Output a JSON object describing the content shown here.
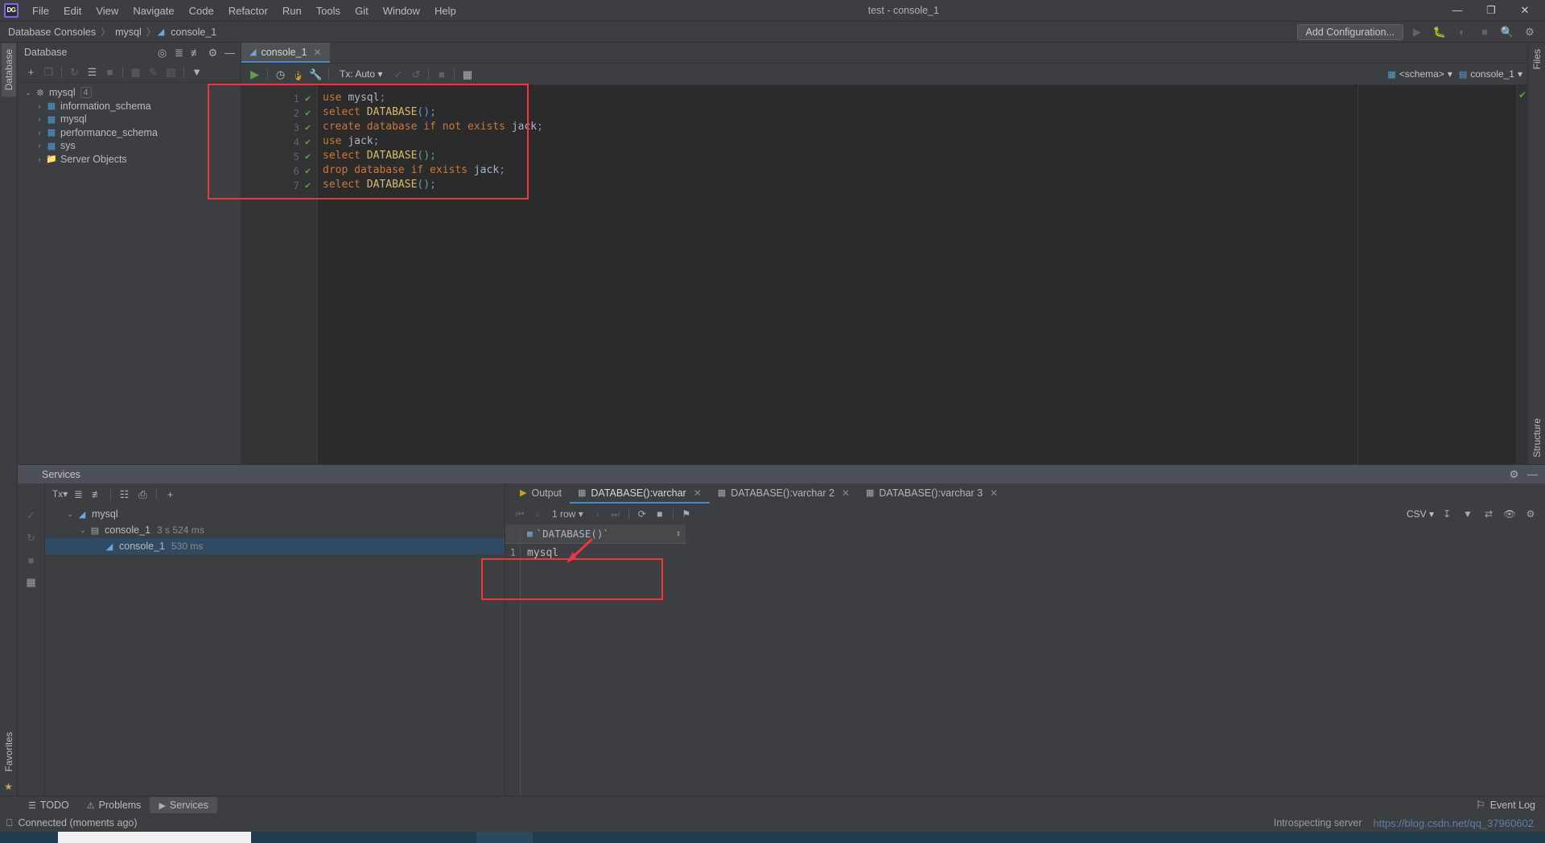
{
  "window": {
    "title": "test - console_1",
    "logo_text": "DG",
    "minimize": "—",
    "maximize": "❐",
    "close": "✕"
  },
  "menu": [
    "File",
    "Edit",
    "View",
    "Navigate",
    "Code",
    "Refactor",
    "Run",
    "Tools",
    "Git",
    "Window",
    "Help"
  ],
  "breadcrumb": {
    "items": [
      "Database Consoles",
      "mysql",
      "console_1"
    ],
    "separator": "〉",
    "console_icon": "console-icon"
  },
  "navbar": {
    "add_configuration": "Add Configuration...",
    "icons": [
      "run-icon",
      "debug-icon",
      "profile-icon",
      "stop-icon",
      "search-icon",
      "settings-icon"
    ]
  },
  "left_strip": {
    "tabs": [
      "Database"
    ],
    "bottom_tabs": [
      "Favorites"
    ]
  },
  "right_strip": {
    "tabs": [
      "Files",
      "Structure"
    ]
  },
  "database_panel": {
    "title": "Database",
    "header_icons": [
      "target-icon",
      "expand-all-icon",
      "collapse-all-icon",
      "settings-icon",
      "hide-icon"
    ],
    "toolbar_icons": [
      "add-icon",
      "copy-icon",
      "refresh-icon",
      "sql-script-icon",
      "stop-icon",
      "table-icon",
      "edit-icon",
      "ql-icon",
      "filter-icon"
    ],
    "tree": [
      {
        "label": "mysql",
        "badge": "4",
        "icon": "loading-icon",
        "arrow": "⌄",
        "indent": 0
      },
      {
        "label": "information_schema",
        "icon": "schema-icon",
        "arrow": "›",
        "indent": 1
      },
      {
        "label": "mysql",
        "icon": "schema-icon",
        "arrow": "›",
        "indent": 1
      },
      {
        "label": "performance_schema",
        "icon": "schema-icon",
        "arrow": "›",
        "indent": 1
      },
      {
        "label": "sys",
        "icon": "schema-icon",
        "arrow": "›",
        "indent": 1
      },
      {
        "label": "Server Objects",
        "icon": "folder-icon",
        "arrow": "›",
        "indent": 1
      }
    ]
  },
  "editor": {
    "tab": {
      "label": "console_1",
      "icon": "console-icon",
      "close": "✕"
    },
    "toolbar": {
      "run": "▶",
      "history_icon": "clock-icon",
      "p_badge": "P",
      "wrench_icon": "wrench-icon",
      "tx_label": "Tx: Auto",
      "commit_icon": "✓",
      "rollback_icon": "↺",
      "stop_icon": "■",
      "grid_icon": "table-icon",
      "schema_selector": "<schema>",
      "session_selector": "console_1"
    },
    "lines": [
      {
        "num": "1",
        "status": "✔",
        "tokens": [
          {
            "t": "use",
            "c": "kw"
          },
          {
            "t": " ",
            "c": "pn"
          },
          {
            "t": "mysql",
            "c": "idn"
          },
          {
            "t": ";",
            "c": "punc"
          }
        ]
      },
      {
        "num": "2",
        "status": "✔",
        "tokens": [
          {
            "t": "select",
            "c": "kw"
          },
          {
            "t": " ",
            "c": "pn"
          },
          {
            "t": "DATABASE",
            "c": "fn"
          },
          {
            "t": "()",
            "c": "punc"
          },
          {
            "t": ";",
            "c": "punc"
          }
        ]
      },
      {
        "num": "3",
        "status": "✔",
        "tokens": [
          {
            "t": "create database if not exists",
            "c": "kw"
          },
          {
            "t": " ",
            "c": "pn"
          },
          {
            "t": "jack",
            "c": "idn"
          },
          {
            "t": ";",
            "c": "punc"
          }
        ]
      },
      {
        "num": "4",
        "status": "✔",
        "tokens": [
          {
            "t": "use",
            "c": "kw"
          },
          {
            "t": " ",
            "c": "pn"
          },
          {
            "t": "jack",
            "c": "idn"
          },
          {
            "t": ";",
            "c": "punc"
          }
        ]
      },
      {
        "num": "5",
        "status": "✔",
        "tokens": [
          {
            "t": "select",
            "c": "kw"
          },
          {
            "t": " ",
            "c": "pn"
          },
          {
            "t": "DATABASE",
            "c": "fn"
          },
          {
            "t": "()",
            "c": "punc"
          },
          {
            "t": ";",
            "c": "punc"
          }
        ]
      },
      {
        "num": "6",
        "status": "✔",
        "tokens": [
          {
            "t": "drop database if exists",
            "c": "kw"
          },
          {
            "t": " ",
            "c": "pn"
          },
          {
            "t": "jack",
            "c": "idn"
          },
          {
            "t": ";",
            "c": "punc"
          }
        ]
      },
      {
        "num": "7",
        "status": "✔",
        "tokens": [
          {
            "t": "select",
            "c": "kw"
          },
          {
            "t": " ",
            "c": "pn"
          },
          {
            "t": "DATABASE",
            "c": "fn"
          },
          {
            "t": "()",
            "c": "punc"
          },
          {
            "t": ";",
            "c": "punc"
          }
        ]
      }
    ],
    "inspection_ok": "✔"
  },
  "services": {
    "title": "Services",
    "header_icons": [
      "settings-icon",
      "hide-icon"
    ],
    "strip_icons": [
      "tx-icon",
      "check-icon",
      "rerun-icon",
      "stop-icon",
      "grid-icon"
    ],
    "toolbar_icons": [
      "tx-icon",
      "expand-all-icon",
      "collapse-all-icon",
      "group-icon",
      "new-tab-icon",
      "add-icon"
    ],
    "tree": [
      {
        "label": "mysql",
        "icon": "console-icon",
        "arrow": "⌄",
        "indent": 1,
        "time": "",
        "selected": false
      },
      {
        "label": "console_1",
        "icon": "process-icon",
        "arrow": "⌄",
        "indent": 2,
        "time": "3 s 524 ms",
        "selected": false
      },
      {
        "label": "console_1",
        "icon": "console-icon",
        "arrow": "",
        "indent": 3,
        "time": "530 ms",
        "selected": true
      }
    ],
    "result_tabs": [
      {
        "label": "Output",
        "icon": "output-icon",
        "closable": false,
        "active": false
      },
      {
        "label": "DATABASE():varchar",
        "icon": "table-icon",
        "closable": true,
        "active": true
      },
      {
        "label": "DATABASE():varchar 2",
        "icon": "table-icon",
        "closable": true,
        "active": false
      },
      {
        "label": "DATABASE():varchar 3",
        "icon": "table-icon",
        "closable": true,
        "active": false
      }
    ],
    "result_toolbar": {
      "first": "⏮",
      "prev": "‹",
      "rowcount": "1 row",
      "next": "›",
      "last": "⏭",
      "refresh": "⟳",
      "stop": "■",
      "pin": "⚑",
      "export_format": "CSV",
      "download_icon": "download-icon",
      "filter_icon": "filter-icon",
      "transpose_icon": "transpose-icon",
      "view_icon": "eye-icon",
      "settings_icon": "settings-icon"
    },
    "grid": {
      "column_header": "`DATABASE()`",
      "header_icon": "column-icon",
      "sort_glyph": "↕",
      "rows": [
        {
          "num": "1",
          "value": "mysql"
        }
      ]
    }
  },
  "bottom_bar": {
    "buttons": [
      {
        "label": "TODO",
        "icon": "todo-icon",
        "active": false
      },
      {
        "label": "Problems",
        "icon": "problems-icon",
        "active": false
      },
      {
        "label": "Services",
        "icon": "services-icon",
        "active": true
      }
    ],
    "event_log": "Event Log",
    "event_log_icon": "bell-icon"
  },
  "status_bar": {
    "icon": "db-icon",
    "text": "Connected (moments ago)",
    "introspecting": "Introspecting server",
    "watermark": "https://blog.csdn.net/qq_37960602"
  },
  "colors": {
    "accent": "#4a88c7",
    "annotation": "#f5333f",
    "keyword": "#cc7832",
    "function": "#d6bb6b",
    "identifier": "#a9b7c6",
    "success": "#5c9f45"
  }
}
